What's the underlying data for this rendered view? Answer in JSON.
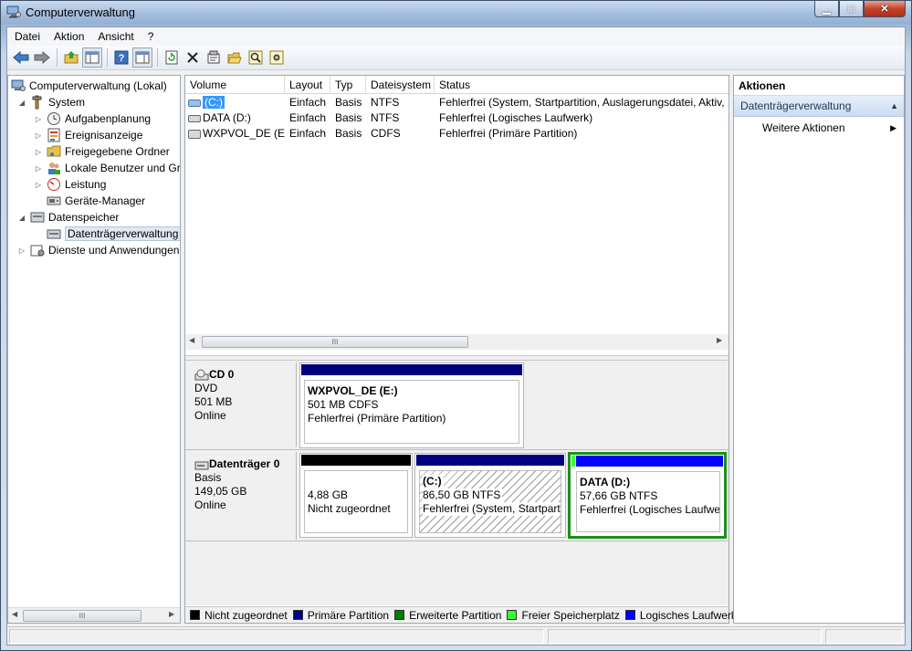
{
  "window": {
    "title": "Computerverwaltung"
  },
  "menu": [
    "Datei",
    "Aktion",
    "Ansicht",
    "?"
  ],
  "toolbar": [
    "back-icon",
    "forward-icon",
    "up-folder-icon",
    "show-tree-icon",
    "help-icon",
    "show-hide-action-icon",
    "refresh-icon",
    "delete-icon",
    "properties-icon",
    "open-icon",
    "search-icon",
    "settings-icon"
  ],
  "tree": {
    "root": "Computerverwaltung (Lokal)",
    "system": "System",
    "aufgaben": "Aufgabenplanung",
    "ereignis": "Ereignisanzeige",
    "freigabe": "Freigegebene Ordner",
    "benutzer": "Lokale Benutzer und Gruppen",
    "leistung": "Leistung",
    "geraete": "Geräte-Manager",
    "datenspeicher": "Datenspeicher",
    "datentraeger": "Datenträgerverwaltung",
    "dienste": "Dienste und Anwendungen"
  },
  "volumes": {
    "headers": [
      "Volume",
      "Layout",
      "Typ",
      "Dateisystem",
      "Status"
    ],
    "rows": [
      {
        "volume": "(C:)",
        "layout": "Einfach",
        "typ": "Basis",
        "fs": "NTFS",
        "status": "Fehlerfrei (System, Startpartition, Auslagerungsdatei, Aktiv, Absturzabbild, Primäre Partition)"
      },
      {
        "volume": "DATA (D:)",
        "layout": "Einfach",
        "typ": "Basis",
        "fs": "NTFS",
        "status": "Fehlerfrei (Logisches Laufwerk)"
      },
      {
        "volume": "WXPVOL_DE (E:)",
        "layout": "Einfach",
        "typ": "Basis",
        "fs": "CDFS",
        "status": "Fehlerfrei (Primäre Partition)"
      }
    ]
  },
  "disks": {
    "cd": {
      "name": "CD 0",
      "type": "DVD",
      "size": "501 MB",
      "state": "Online",
      "partition": {
        "name": "WXPVOL_DE  (E:)",
        "size": "501 MB CDFS",
        "status": "Fehlerfrei (Primäre Partition)",
        "color": "#00007f"
      }
    },
    "disk0": {
      "name": "Datenträger 0",
      "type": "Basis",
      "size": "149,05 GB",
      "state": "Online",
      "partitions": [
        {
          "name": "",
          "size": "4,88 GB",
          "status": "Nicht zugeordnet",
          "color": "#000000"
        },
        {
          "name": "(C:)",
          "size": "86,50 GB NTFS",
          "status": "Fehlerfrei (System, Startpartition",
          "color": "#00007f"
        },
        {
          "name": "DATA  (D:)",
          "size": "57,66 GB NTFS",
          "status": "Fehlerfrei (Logisches Laufwerk)",
          "color": "#0000ff"
        }
      ]
    }
  },
  "legend": [
    {
      "label": "Nicht zugeordnet",
      "color": "#000000"
    },
    {
      "label": "Primäre Partition",
      "color": "#00007f"
    },
    {
      "label": "Erweiterte Partition",
      "color": "#007f00"
    },
    {
      "label": "Freier Speicherplatz",
      "color": "#33ff33"
    },
    {
      "label": "Logisches Laufwerk",
      "color": "#0000ff"
    }
  ],
  "actions": {
    "title": "Aktionen",
    "section": "Datenträgerverwaltung",
    "item": "Weitere Aktionen"
  },
  "scroll": {
    "grip": "III"
  }
}
